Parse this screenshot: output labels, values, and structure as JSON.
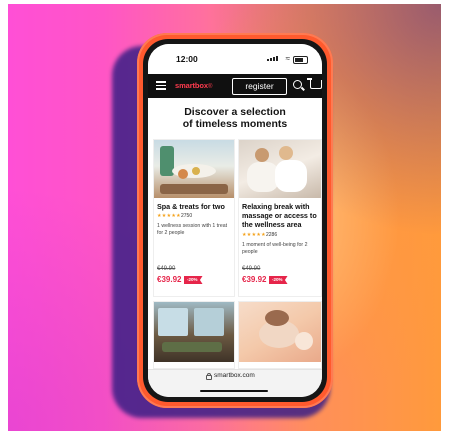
{
  "phone": {
    "status": {
      "time": "12:00"
    },
    "nav": {
      "logo": "smartbox",
      "logo_mark": "®",
      "register_label": "register",
      "icons": [
        "menu-icon",
        "search-icon",
        "cart-icon"
      ]
    },
    "heading_line1": "Discover a selection",
    "heading_line2": "of timeless moments",
    "products": [
      {
        "title": "Spa & treats for two",
        "stars": "★★★★★",
        "rating_count": "2750",
        "description": "1 wellness session with 1 treat for 2 people",
        "old_price": "€49.90",
        "new_price": "€39.92",
        "discount": "-20%"
      },
      {
        "title": "Relaxing break with massage or access to the wellness area",
        "stars": "★★★★★",
        "rating_count": "2286",
        "description": "1 moment of well-being for 2 people",
        "old_price": "€49.90",
        "new_price": "€39.92",
        "discount": "-20%"
      }
    ],
    "url": "smartbox.com"
  },
  "colors": {
    "accent_red": "#e6254a",
    "navbar": "#101010",
    "phone_frame": "#ff5a2e",
    "stars": "#f4a21b"
  }
}
